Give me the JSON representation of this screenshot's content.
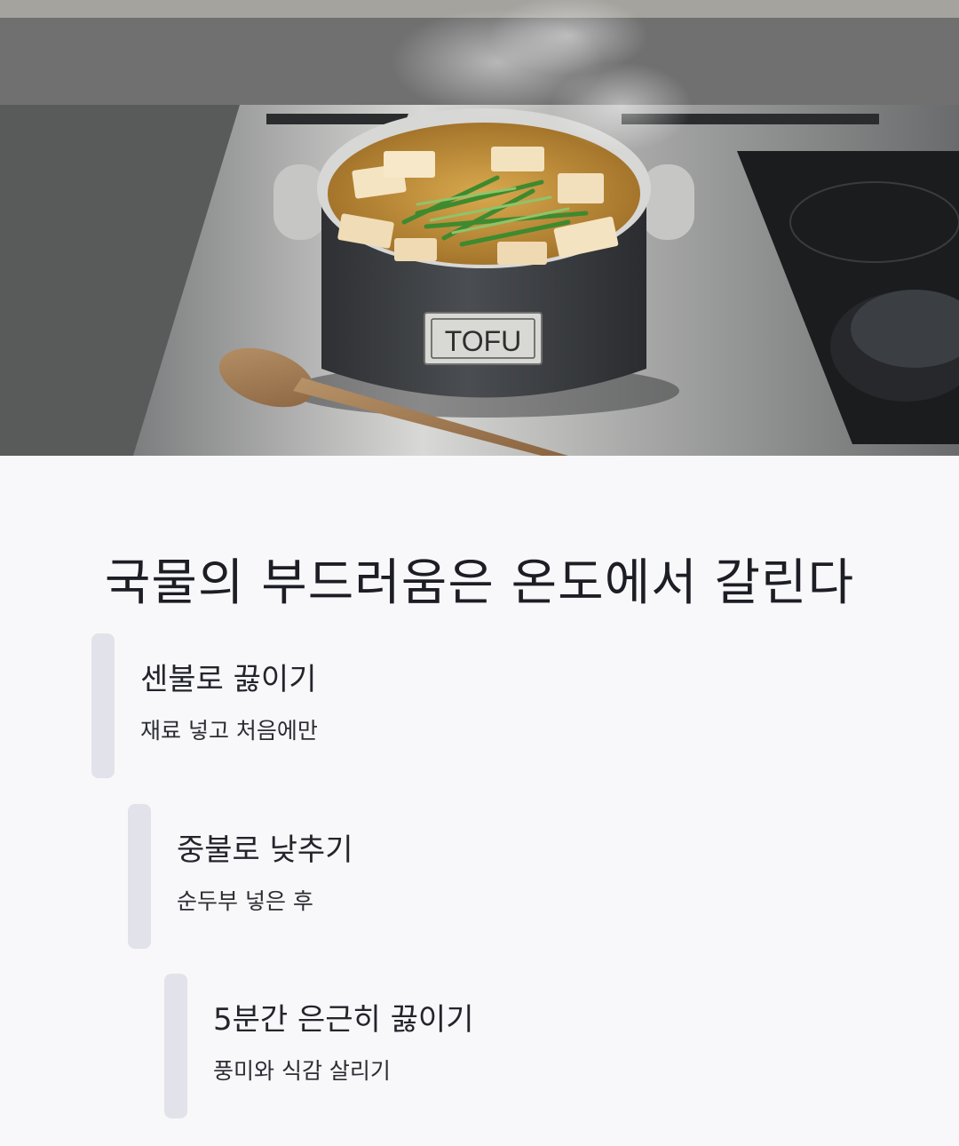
{
  "hero": {
    "image": "pot-of-soft-tofu-stew-on-stove",
    "pot_label": "TOFU"
  },
  "title": "국물의 부드러움은 온도에서 갈린다",
  "steps": [
    {
      "heading": "센불로 끓이기",
      "detail": "재료 넣고 처음에만"
    },
    {
      "heading": "중불로 낮추기",
      "detail": "순두부 넣은 후"
    },
    {
      "heading": "5분간 은근히 끓이기",
      "detail": "풍미와 식감 살리기"
    }
  ]
}
